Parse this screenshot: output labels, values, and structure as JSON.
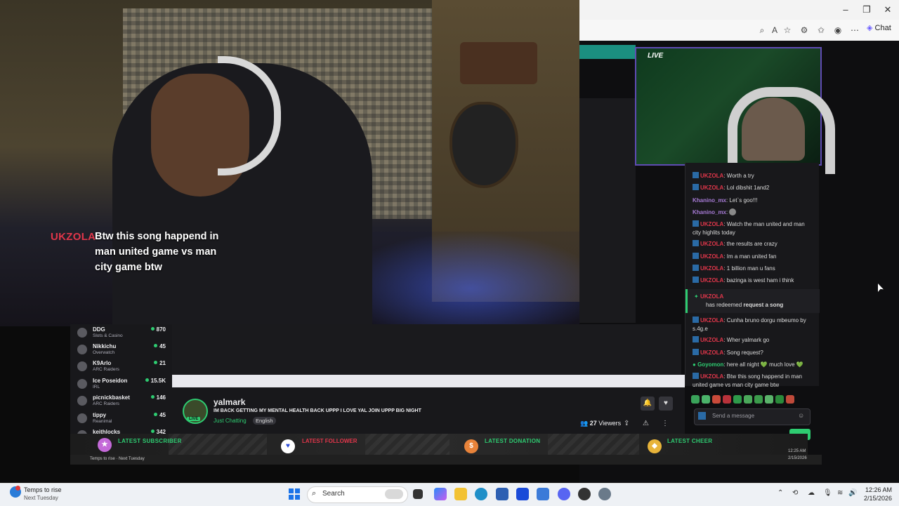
{
  "webcam": {
    "caption_user": "UKZOLA",
    "caption_lines": [
      "Btw this song happend in",
      "man united game vs man",
      "city game btw"
    ]
  },
  "browser": {
    "chat_button": "Chat",
    "window_controls": [
      "minimize-icon",
      "maximize-icon",
      "close-icon"
    ]
  },
  "stream_preview": {
    "live_label": "LIVE"
  },
  "chat": {
    "messages": [
      {
        "user": "UKZOLA",
        "text": "Worth a try"
      },
      {
        "user": "UKZOLA",
        "text": "Lol dibshit 1and2"
      },
      {
        "user": "Khanino_mx",
        "text": "Let`s goo!!!"
      },
      {
        "user": "Khanino_mx",
        "text": ""
      },
      {
        "user": "UKZOLA",
        "text": "Watch the man united and man city highlits today"
      },
      {
        "user": "UKZOLA",
        "text": "the results are crazy"
      },
      {
        "user": "UKZOLA",
        "text": "Im a man united fan"
      },
      {
        "user": "UKZOLA",
        "text": "1 billion man u fans"
      },
      {
        "user": "UKZOLA",
        "text": "bazinga is west ham i think"
      }
    ],
    "redeem_user": "UKZOLA",
    "redeem_text": "has redeemed",
    "redeem_reward": "request a song",
    "messages2": [
      {
        "user": "UKZOLA",
        "text": "Cunha bruno dorgu mbeumo by s.4g.e"
      },
      {
        "user": "UKZOLA",
        "text": "Wher yalmark go"
      },
      {
        "user": "UKZOLA",
        "text": "Song request?"
      },
      {
        "user": "Goyomon",
        "text": "here all night 💚 much love 💚"
      },
      {
        "user": "UKZOLA",
        "text": "Btw this song happend in man united game vs man city game btw"
      }
    ],
    "input_placeholder": "Send a message"
  },
  "followed_channels": [
    {
      "name": "DDG",
      "category": "Slots & Casino",
      "viewers": "870"
    },
    {
      "name": "Nikkichu",
      "category": "Overwatch",
      "viewers": "45"
    },
    {
      "name": "K9Arlo",
      "category": "ARC Raiders",
      "viewers": "21"
    },
    {
      "name": "Ice Poseidon",
      "category": "IRL",
      "viewers": "15.5K"
    },
    {
      "name": "picnickbasket",
      "category": "ARC Raiders",
      "viewers": "146"
    },
    {
      "name": "tippy",
      "category": "Reanimal",
      "viewers": "45"
    },
    {
      "name": "keithlocks",
      "category": "",
      "viewers": "342"
    }
  ],
  "streamer": {
    "name": "yalmark",
    "title": "IM BACK GETTING MY MENTAL HEALTH BACK UPPP I LOVE YAL JOIN UPPP BIG NIGHT",
    "category": "Just Chatting",
    "language": "English",
    "live_badge": "LIVE",
    "viewers": "27",
    "viewers_label": "Viewers"
  },
  "alerts": {
    "latest_subscriber": "LATEST SUBSCRIBER",
    "latest_follower": "LATEST FOLLOWER",
    "latest_donation": "LATEST DONATION",
    "latest_cheer": "LATEST CHEER"
  },
  "nested_taskbar": {
    "weather1": "Temps to rise",
    "weather2": "Next Tuesday",
    "time": "12:25 AM",
    "date": "2/15/2026"
  },
  "taskbar": {
    "weather_line1": "Temps to rise",
    "weather_line2": "Next Tuesday",
    "search_placeholder": "Search",
    "time": "12:26 AM",
    "date": "2/15/2026"
  },
  "colors": {
    "twitch_bg": "#0e0e10",
    "accent_red": "#e0364a",
    "accent_green": "#2ecc71",
    "taskbar_bg": "#eef1f5"
  }
}
